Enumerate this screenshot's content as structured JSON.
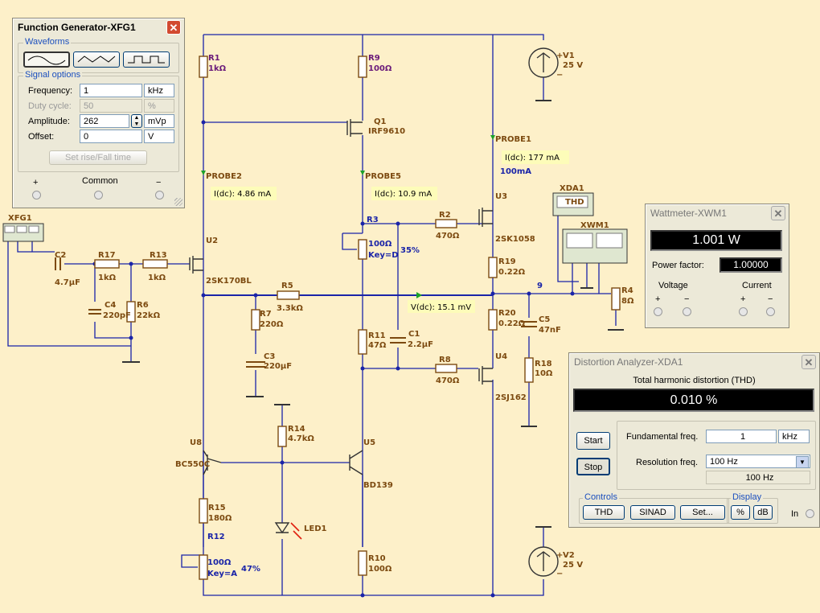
{
  "schematic": {
    "labels": {
      "r1": "R1",
      "r1v": "1kΩ",
      "r9": "R9",
      "r9v": "100Ω",
      "q1": "Q1",
      "q1v": "IRF9610",
      "v1": "V1",
      "v1v": "25 V",
      "probe1": "PROBE1",
      "probe1_val": "I(dc): 177 mA",
      "probe1_extra": "100mA",
      "probe2": "PROBE2",
      "probe2_val": "I(dc): 4.86 mA",
      "probe5": "PROBE5",
      "probe5_val": "I(dc): 10.9 mA",
      "xfg1": "XFG1",
      "u2": "U2",
      "u2v": "2SK170BL",
      "r3": "R3",
      "r3v": "100Ω",
      "r3key": "Key=D",
      "r3pct": "35%",
      "r2": "R2",
      "r2v": "470Ω",
      "u3": "U3",
      "u3v": "2SK1058",
      "xda1": "XDA1",
      "xda1_tag": "THD",
      "xwm1": "XWM1",
      "c2": "C2",
      "c2v": "4.7µF",
      "r17": "R17",
      "r17v": "1kΩ",
      "r13": "R13",
      "r13v": "1kΩ",
      "r19": "R19",
      "r19v": "0.22Ω",
      "node9": "9",
      "r4": "R4",
      "r4v": "8Ω",
      "r5": "R5",
      "r5v": "3.3kΩ",
      "c4": "C4",
      "c4v": "220pF",
      "r6": "R6",
      "r6v": "22kΩ",
      "r7": "R7",
      "r7v": "220Ω",
      "vdc": "V(dc): 15.1 mV",
      "r20": "R20",
      "r20v": "0.22Ω",
      "c5": "C5",
      "c5v": "47nF",
      "r11": "R11",
      "r11v": "47Ω",
      "c1": "C1",
      "c1v": "2.2µF",
      "c3": "C3",
      "c3v": "220µF",
      "u4": "U4",
      "u4v": "2SJ162",
      "r8": "R8",
      "r8v": "470Ω",
      "r18": "R18",
      "r18v": "10Ω",
      "r14": "R14",
      "r14v": "4.7kΩ",
      "u8": "U8",
      "u8v": "BC550C",
      "u5": "U5",
      "u5v": "BD139",
      "r15": "R15",
      "r15v": "180Ω",
      "r12": "R12",
      "r12v": "100Ω",
      "r12key": "Key=A",
      "r12pct": "47%",
      "led1": "LED1",
      "r10": "R10",
      "r10v": "100Ω",
      "v2": "V2",
      "v2v": "25 V",
      "plus": "+",
      "minus": "−"
    }
  },
  "function_generator": {
    "title": "Function Generator-XFG1",
    "close": "✕",
    "waveforms_label": "Waveforms",
    "waveforms": [
      "sine",
      "triangle",
      "square"
    ],
    "selected_waveform": "sine",
    "signal_options_label": "Signal options",
    "rows": [
      {
        "label": "Frequency:",
        "value": "1",
        "unit": "kHz",
        "enabled": true,
        "spinner": false
      },
      {
        "label": "Duty cycle:",
        "value": "50",
        "unit": "%",
        "enabled": false,
        "spinner": false
      },
      {
        "label": "Amplitude:",
        "value": "262",
        "unit": "mVp",
        "enabled": true,
        "spinner": true
      },
      {
        "label": "Offset:",
        "value": "0",
        "unit": "V",
        "enabled": true,
        "spinner": false
      }
    ],
    "rise_fall_button": "Set rise/Fall time",
    "terminal_plus": "+",
    "terminal_common": "Common",
    "terminal_minus": "−"
  },
  "wattmeter": {
    "title": "Wattmeter-XWM1",
    "close": "✕",
    "reading": "1.001 W",
    "power_factor_label": "Power factor:",
    "power_factor": "1.00000",
    "voltage_label": "Voltage",
    "current_label": "Current",
    "plus": "+",
    "minus": "−"
  },
  "distortion_analyzer": {
    "title": "Distortion Analyzer-XDA1",
    "close": "✕",
    "thd_label": "Total harmonic distortion (THD)",
    "reading": "0.010 %",
    "start_button": "Start",
    "stop_button": "Stop",
    "fundamental_label": "Fundamental freq.",
    "fundamental_value": "1",
    "fundamental_unit": "kHz",
    "resolution_label": "Resolution freq.",
    "resolution_value": "100 Hz",
    "resolution_display": "100 Hz",
    "controls_label": "Controls",
    "thd_button": "THD",
    "sinad_button": "SINAD",
    "set_button": "Set...",
    "display_label": "Display",
    "percent_button": "%",
    "db_button": "dB",
    "in_label": "In"
  }
}
